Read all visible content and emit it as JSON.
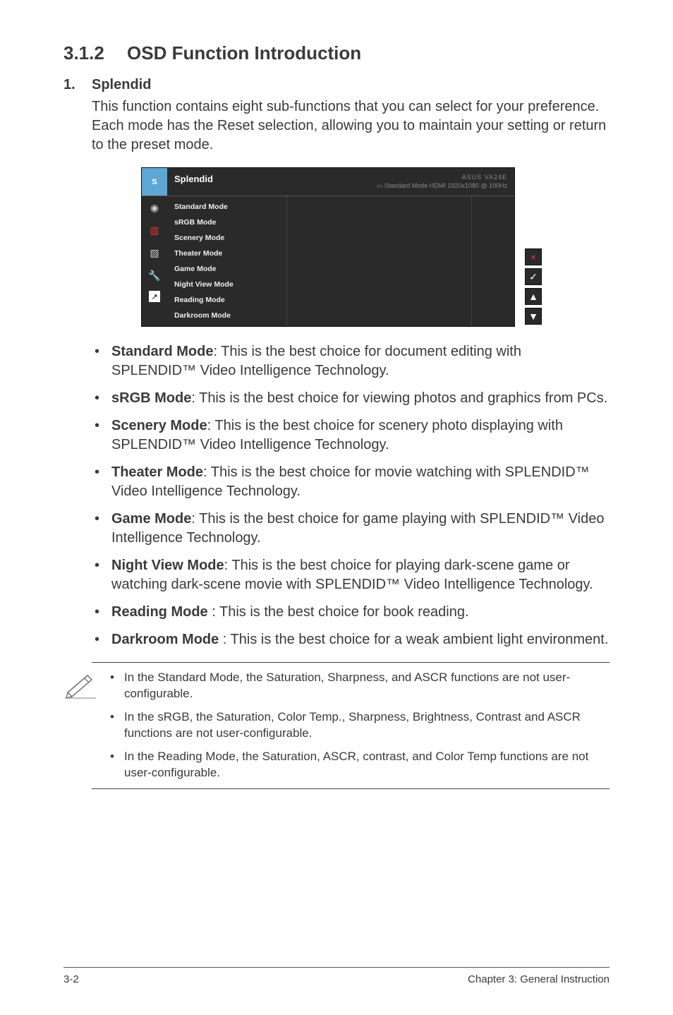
{
  "heading": {
    "number": "3.1.2",
    "title": "OSD Function Introduction"
  },
  "section1": {
    "number": "1.",
    "label": "Splendid",
    "intro": "This function contains eight sub-functions that you can select for your preference. Each mode has the Reset selection, allowing you to maintain your setting or return to the preset mode."
  },
  "osd": {
    "title": "Splendid",
    "model": "ASUS  VA24E",
    "status": "Standard Mode  HDMI  1920x1080 @ 100Hz",
    "sidebar_icons": [
      "eye-icon",
      "bars-icon",
      "picture-icon",
      "wrench-icon",
      "arrow-box-icon"
    ],
    "items": [
      "Standard Mode",
      "sRGB Mode",
      "Scenery Mode",
      "Theater Mode",
      "Game Mode",
      "Night View Mode",
      "Reading Mode",
      "Darkroom Mode"
    ],
    "buttons": [
      "×",
      "✓",
      "▲",
      "▼"
    ]
  },
  "modes": [
    {
      "name": "Standard Mode",
      "desc": ": This is the best choice for document editing with SPLENDID™ Video Intelligence Technology."
    },
    {
      "name": "sRGB Mode",
      "desc": ": This is the best choice for viewing photos and graphics from PCs."
    },
    {
      "name": "Scenery Mode",
      "desc": ": This is the best choice for scenery photo displaying with SPLENDID™ Video Intelligence Technology."
    },
    {
      "name": "Theater Mode",
      "desc": ": This is the best choice for movie watching with SPLENDID™ Video Intelligence Technology."
    },
    {
      "name": "Game Mode",
      "desc": ": This is the best choice for game playing with SPLENDID™ Video Intelligence Technology."
    },
    {
      "name": "Night View Mode",
      "desc": ": This is the best choice for playing dark-scene game or watching dark-scene movie with SPLENDID™ Video Intelligence Technology."
    },
    {
      "name": "Reading Mode",
      "desc": " : This is the best choice for book reading."
    },
    {
      "name": "Darkroom Mode",
      "desc": " : This is the best choice for a weak ambient light environment."
    }
  ],
  "notes": [
    "In the Standard Mode, the Saturation, Sharpness, and ASCR functions are not user-configurable.",
    "In the sRGB, the Saturation, Color Temp., Sharpness, Brightness, Contrast and ASCR functions are not user-configurable.",
    "In the Reading Mode, the Saturation, ASCR, contrast, and Color Temp functions are not user-configurable."
  ],
  "footer": {
    "left": "3-2",
    "right": "Chapter 3: General Instruction"
  }
}
